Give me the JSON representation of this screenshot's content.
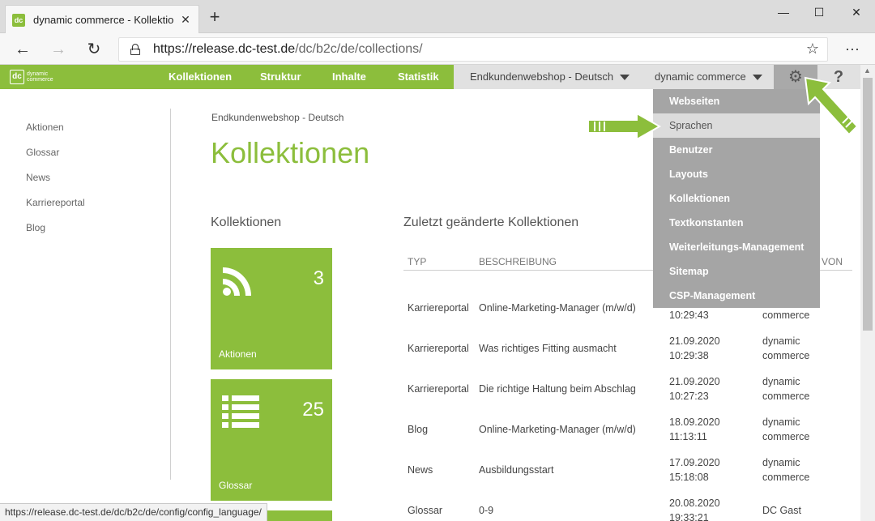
{
  "browser": {
    "tab_title": "dynamic commerce - Kollektionen",
    "tab_close": "✕",
    "new_tab": "+",
    "url_main": "https://release.dc-test.de",
    "url_path": "/dc/b2c/de/collections/",
    "status_url": "https://release.dc-test.de/dc/b2c/de/config/config_language/"
  },
  "nav": {
    "logo_mark": "dc",
    "logo_line1": "dynamic",
    "logo_line2": "commerce",
    "links": [
      "Kollektionen",
      "Struktur",
      "Inhalte",
      "Statistik"
    ],
    "shop_select": "Endkundenwebshop - Deutsch",
    "company_select": "dynamic commerce",
    "help": "?"
  },
  "sidebar": {
    "items": [
      "Aktionen",
      "Glossar",
      "News",
      "Karriereportal",
      "Blog"
    ]
  },
  "main": {
    "breadcrumb": "Endkundenwebshop - Deutsch",
    "title": "Kollektionen",
    "collections_title": "Kollektionen",
    "recent_title": "Zuletzt geänderte Kollektionen",
    "tiles": [
      {
        "label": "Aktionen",
        "count": "3",
        "icon": "rss-icon"
      },
      {
        "label": "Glossar",
        "count": "25",
        "icon": "list-icon"
      }
    ]
  },
  "table": {
    "headers": {
      "typ": "TYP",
      "beschreibung": "BESCHREIBUNG",
      "von": "VON"
    },
    "first_row_partial": {
      "time": "10:29:43",
      "user": "commerce"
    },
    "rows": [
      {
        "typ": "Karriereportal",
        "beschreibung": "Online-Marketing-Manager (m/w/d)",
        "date": "",
        "time": "",
        "user1": "",
        "user2": ""
      },
      {
        "typ": "Karriereportal",
        "beschreibung": "Was richtiges Fitting ausmacht",
        "date": "21.09.2020",
        "time": "10:29:38",
        "user1": "dynamic",
        "user2": "commerce"
      },
      {
        "typ": "Karriereportal",
        "beschreibung": "Die richtige Haltung beim Abschlag",
        "date": "21.09.2020",
        "time": "10:27:23",
        "user1": "dynamic",
        "user2": "commerce"
      },
      {
        "typ": "Blog",
        "beschreibung": "Online-Marketing-Manager (m/w/d)",
        "date": "18.09.2020",
        "time": "11:13:11",
        "user1": "dynamic",
        "user2": "commerce"
      },
      {
        "typ": "News",
        "beschreibung": "Ausbildungsstart",
        "date": "17.09.2020",
        "time": "15:18:08",
        "user1": "dynamic",
        "user2": "commerce"
      },
      {
        "typ": "Glossar",
        "beschreibung": "0-9",
        "date": "20.08.2020",
        "time": "19:33:21",
        "user1": "DC Gast",
        "user2": ""
      }
    ]
  },
  "settings_menu": {
    "items": [
      "Webseiten",
      "Sprachen",
      "Benutzer",
      "Layouts",
      "Kollektionen",
      "Textkonstanten",
      "Weiterleitungs-Management",
      "Sitemap",
      "CSP-Management"
    ],
    "active_index": 1
  },
  "colors": {
    "brand_green": "#8cbe3c",
    "dropdown_gray": "#a5a5a5",
    "nav_gray": "#e1e1e1"
  }
}
